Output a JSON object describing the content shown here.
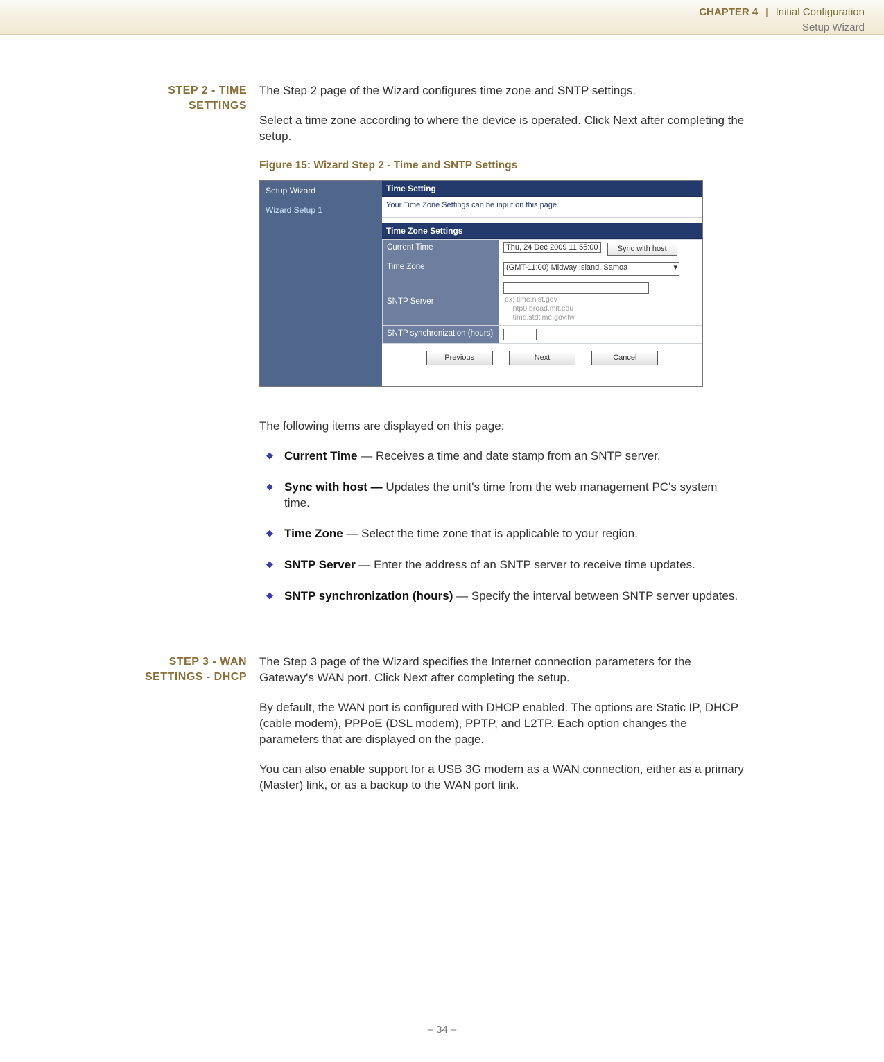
{
  "header": {
    "chapter": "CHAPTER 4",
    "sep": "|",
    "title": "Initial Configuration",
    "sub": "Setup Wizard"
  },
  "step2": {
    "side_line1": "STEP 2 - TIME",
    "side_line2": "SETTINGS",
    "p1": "The Step 2 page of the Wizard configures time zone and SNTP settings.",
    "p2": "Select a time zone according to where the device is operated. Click Next after completing the setup.",
    "figcap": "Figure 15:  Wizard Step 2 - Time and SNTP Settings",
    "items_intro": "The following items are displayed on this page:",
    "bullets": [
      {
        "term": "Current Time",
        "desc": " — Receives a time and date stamp from an SNTP server."
      },
      {
        "term": "Sync with host —",
        "desc": " Updates the unit's time from the web management PC's system time."
      },
      {
        "term": "Time Zone",
        "desc": " —  Select the time zone that is applicable to your region."
      },
      {
        "term": "SNTP Server",
        "desc": " — Enter the address of an SNTP server to receive time updates."
      },
      {
        "term": "SNTP synchronization (hours)",
        "desc": " — Specify the interval between SNTP server updates."
      }
    ]
  },
  "figure": {
    "left": {
      "row1": "Setup Wizard",
      "row2": "Wizard Setup 1"
    },
    "panel_title": "Time Setting",
    "panel_sub": "Your Time Zone Settings can be input on this page.",
    "tz_title": "Time Zone Settings",
    "rows": {
      "current_time_label": "Current Time",
      "current_time_value": "Thu, 24 Dec 2009 11:55:00",
      "sync_btn": "Sync with host",
      "time_zone_label": "Time Zone",
      "time_zone_value": "(GMT-11:00) Midway Island, Samoa",
      "sntp_server_label": "SNTP Server",
      "sntp_server_hint": "ex: time.nist.gov\n    ntp0.broad.mit.edu\n    time.stdtime.gov.tw",
      "sntp_sync_label": "SNTP synchronization (hours)"
    },
    "buttons": {
      "prev": "Previous",
      "next": "Next",
      "cancel": "Cancel"
    }
  },
  "step3": {
    "side_line1": "STEP 3 - WAN",
    "side_line2": "SETTINGS - DHCP",
    "p1": "The Step 3 page of the Wizard specifies the Internet connection parameters for the Gateway's WAN port. Click Next after completing the setup.",
    "p2": "By default, the WAN port is configured with DHCP enabled. The options are Static IP, DHCP (cable modem), PPPoE (DSL modem), PPTP, and L2TP. Each option changes the parameters that are displayed on the page.",
    "p3": "You can also enable support for a USB 3G modem as a WAN connection, either as a primary (Master) link, or as a backup to the WAN port link."
  },
  "footer": "–  34  –"
}
